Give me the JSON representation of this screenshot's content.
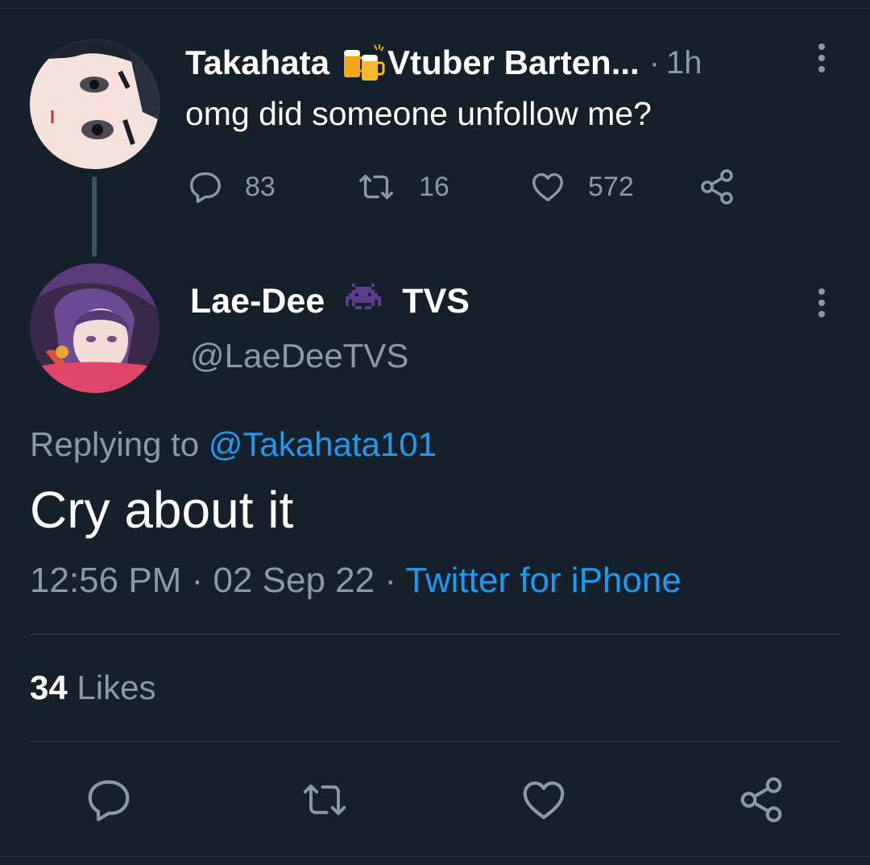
{
  "parent_tweet": {
    "author_name": "Takahata",
    "author_name_suffix": "Vtuber Barten...",
    "emoji": "beer-mugs-emoji",
    "separator": "·",
    "time": "1h",
    "text": "omg did someone unfollow me?",
    "replies": "83",
    "retweets": "16",
    "likes": "572"
  },
  "reply_tweet": {
    "author_name": "Lae-Dee",
    "emoji": "space-invader-emoji",
    "author_team": "TVS",
    "handle": "@LaeDeeTVS",
    "replying_prefix": "Replying to",
    "replying_mention": "@Takahata101",
    "text": "Cry about it",
    "time": "12:56 PM",
    "sep1": "·",
    "date": "02 Sep 22",
    "sep2": "·",
    "source": "Twitter for iPhone",
    "likes_count": "34",
    "likes_label": "Likes"
  },
  "icons": [
    "reply-icon",
    "retweet-icon",
    "like-icon",
    "share-icon",
    "more-icon"
  ],
  "colors": {
    "background": "#15202b",
    "text": "#ffffff",
    "muted": "#8b98a5",
    "link": "#1d9bf0",
    "divider": "#38444d"
  }
}
